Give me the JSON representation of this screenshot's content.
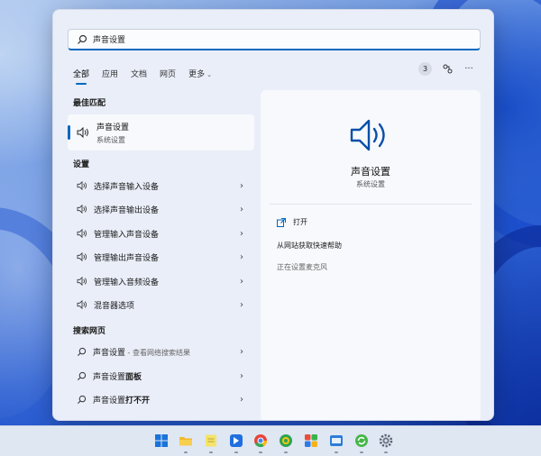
{
  "search": {
    "value": "声音设置"
  },
  "tabs": [
    {
      "label": "全部",
      "active": true
    },
    {
      "label": "应用"
    },
    {
      "label": "文档"
    },
    {
      "label": "网页"
    },
    {
      "label": "更多"
    }
  ],
  "header_right": {
    "count": "3",
    "icons": [
      "share-icon",
      "more-icon"
    ]
  },
  "best_match": {
    "section": "最佳匹配",
    "title": "声音设置",
    "subtitle": "系统设置",
    "icon": "speaker-icon"
  },
  "settings": {
    "section": "设置",
    "items": [
      {
        "label": "选择声音输入设备"
      },
      {
        "label": "选择声音输出设备"
      },
      {
        "label": "管理输入声音设备"
      },
      {
        "label": "管理输出声音设备"
      },
      {
        "label": "管理输入音频设备"
      },
      {
        "label": "混音器选项"
      }
    ]
  },
  "web": {
    "section": "搜索网页",
    "items": [
      {
        "label": "声音设置",
        "sub": " - 查看网络搜索结果"
      },
      {
        "label": "声音设置",
        "bold": "面板"
      },
      {
        "label": "声音设置",
        "bold": "打不开"
      }
    ]
  },
  "preview": {
    "name": "声音设置",
    "category": "系统设置",
    "actions": [
      {
        "label": "打开",
        "icon": "open-icon"
      },
      {
        "label": "从网站获取快速帮助"
      },
      {
        "label": "正在设置麦克风"
      }
    ]
  },
  "taskbar": {
    "icons": [
      "windows-icon",
      "file-explorer-icon",
      "notes-icon",
      "feishu-icon",
      "chrome-icon",
      "browser-360-icon",
      "app-grid-icon",
      "app-s3-icon",
      "refresh-app-icon",
      "settings-icon"
    ]
  }
}
